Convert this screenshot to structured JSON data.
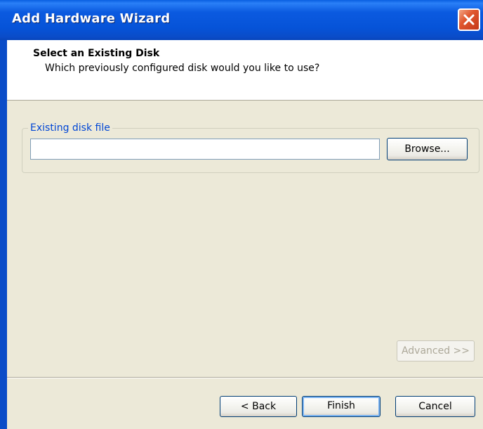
{
  "window": {
    "title": "Add Hardware Wizard",
    "close_icon": "close-icon",
    "accent_color": "#0a4cc8"
  },
  "header": {
    "title": "Select an Existing Disk",
    "subtitle": "Which previously configured disk would you like to use?"
  },
  "disk_group": {
    "label": "Existing disk file",
    "input_value": "",
    "browse_label": "Browse..."
  },
  "advanced": {
    "label": "Advanced >>",
    "enabled": false
  },
  "footer": {
    "back_label": "< Back",
    "finish_label": "Finish",
    "cancel_label": "Cancel"
  }
}
